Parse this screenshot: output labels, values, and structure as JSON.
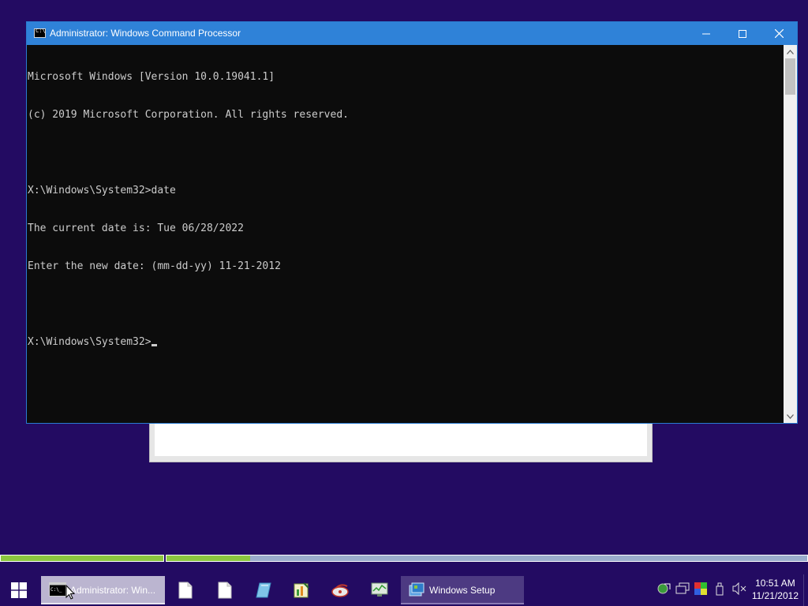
{
  "window": {
    "title": "Administrator: Windows Command Processor"
  },
  "console": {
    "lines": [
      "Microsoft Windows [Version 10.0.19041.1]",
      "(c) 2019 Microsoft Corporation. All rights reserved.",
      "",
      "X:\\Windows\\System32>date",
      "The current date is: Tue 06/28/2022",
      "Enter the new date: (mm-dd-yy) 11-21-2012",
      "",
      "X:\\Windows\\System32>"
    ]
  },
  "progress": {
    "bar1_fraction": 1.0,
    "bar2_fraction": 0.13
  },
  "taskbar": {
    "cmd_task_label": "Administrator: Win...",
    "setup_task_label": "Windows Setup",
    "pinned_icons": [
      "notepad-icon",
      "document-icon",
      "paint-icon",
      "registry-editor-icon",
      "disk-icon",
      "task-manager-icon"
    ],
    "tray_icons": [
      "network-icon",
      "monitor-icon",
      "color-icon",
      "usb-icon",
      "volume-muted-icon"
    ]
  },
  "clock": {
    "time": "10:51 AM",
    "date": "11/21/2012"
  },
  "colors": {
    "desktop": "#230b62",
    "titlebar": "#2f82d8",
    "console_bg": "#0c0c0c",
    "console_text": "#cccccc",
    "progress_fill": "#8cc63f"
  }
}
